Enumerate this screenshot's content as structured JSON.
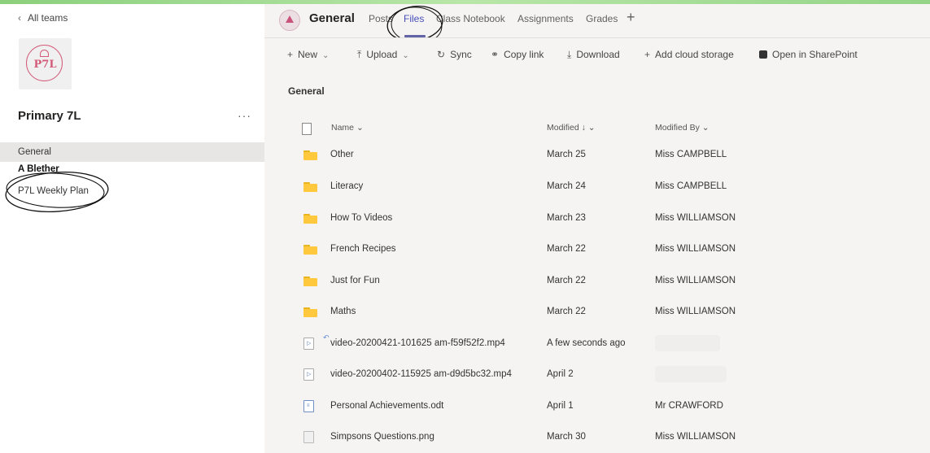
{
  "sidebar": {
    "back_label": "All teams",
    "logo_text": "P7L",
    "team_name": "Primary 7L",
    "more_label": "···",
    "channels": [
      {
        "label": "General"
      },
      {
        "label": "A Blether"
      },
      {
        "label": "P7L Weekly Plan"
      }
    ]
  },
  "header": {
    "channel_title": "General",
    "tabs": [
      {
        "label": "Posts"
      },
      {
        "label": "Files"
      },
      {
        "label": "Class Notebook"
      },
      {
        "label": "Assignments"
      },
      {
        "label": "Grades"
      }
    ],
    "add_tab": "+"
  },
  "toolbar": {
    "new": "New",
    "upload": "Upload",
    "sync": "Sync",
    "copy_link": "Copy link",
    "download": "Download",
    "add_cloud": "Add cloud storage",
    "open_sharepoint": "Open in SharePoint"
  },
  "files": {
    "folder_label": "General",
    "columns": {
      "name": "Name",
      "modified": "Modified",
      "modified_by": "Modified By"
    },
    "rows": [
      {
        "name": "Other",
        "modified": "March 25",
        "by": "Miss CAMPBELL",
        "type": "folder"
      },
      {
        "name": "Literacy",
        "modified": "March 24",
        "by": "Miss CAMPBELL",
        "type": "folder"
      },
      {
        "name": "How To Videos",
        "modified": "March 23",
        "by": "Miss WILLIAMSON",
        "type": "folder"
      },
      {
        "name": "French Recipes",
        "modified": "March 22",
        "by": "Miss WILLIAMSON",
        "type": "folder"
      },
      {
        "name": "Just for Fun",
        "modified": "March 22",
        "by": "Miss WILLIAMSON",
        "type": "folder"
      },
      {
        "name": "Maths",
        "modified": "March 22",
        "by": "Miss WILLIAMSON",
        "type": "folder"
      },
      {
        "name": "video-20200421-101625 am-f59f52f2.mp4",
        "modified": "A few seconds ago",
        "by": "",
        "type": "video"
      },
      {
        "name": "video-20200402-115925 am-d9d5bc32.mp4",
        "modified": "April 2",
        "by": "",
        "type": "video"
      },
      {
        "name": "Personal Achievements.odt",
        "modified": "April 1",
        "by": "Mr CRAWFORD",
        "type": "doc"
      },
      {
        "name": "Simpsons Questions.png",
        "modified": "March 30",
        "by": "Miss WILLIAMSON",
        "type": "image"
      }
    ]
  },
  "colors": {
    "accent": "#6264a7",
    "folder": "#ffc83d",
    "logo": "#d35b79"
  }
}
